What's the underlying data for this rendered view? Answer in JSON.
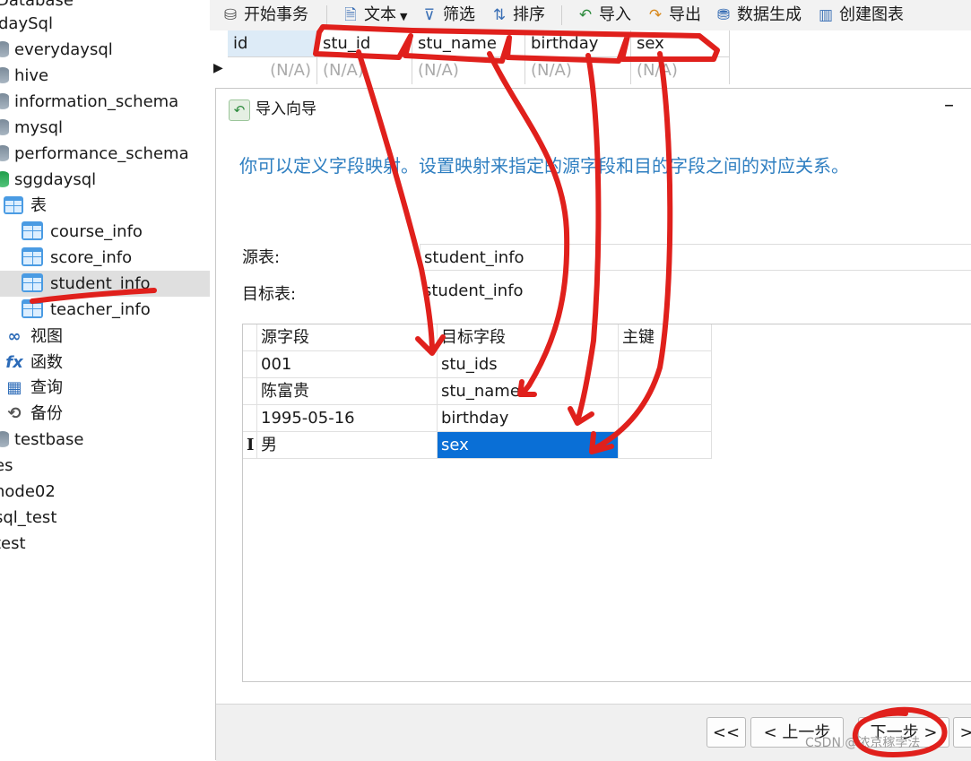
{
  "sidebar": {
    "items": [
      {
        "label": "Database"
      },
      {
        "label": "daySql"
      },
      {
        "label": "everydaysql"
      },
      {
        "label": "hive"
      },
      {
        "label": "information_schema"
      },
      {
        "label": "mysql"
      },
      {
        "label": "performance_schema"
      },
      {
        "label": "sggdaysql"
      },
      {
        "label": "表"
      },
      {
        "label": "course_info"
      },
      {
        "label": "score_info"
      },
      {
        "label": "student_info"
      },
      {
        "label": "teacher_info"
      },
      {
        "label": "视图"
      },
      {
        "label": "函数"
      },
      {
        "label": "查询"
      },
      {
        "label": "备份"
      },
      {
        "label": "testbase"
      },
      {
        "label": "es"
      },
      {
        "label": "node02"
      },
      {
        "label": "sql_test"
      },
      {
        "label": "test"
      }
    ]
  },
  "toolbar": {
    "begin_tx": "开始事务",
    "text": "文本",
    "filter": "筛选",
    "sort": "排序",
    "import": "导入",
    "export": "导出",
    "data_gen": "数据生成",
    "create_chart": "创建图表"
  },
  "grid": {
    "columns": [
      "id",
      "stu_id",
      "stu_name",
      "birthday",
      "sex"
    ],
    "null_value": "(N/A)"
  },
  "dialog": {
    "title": "导入向导",
    "description": "你可以定义字段映射。设置映射来指定的源字段和目的字段之间的对应关系。",
    "source_label": "源表:",
    "source_value": "student_info",
    "target_label": "目标表:",
    "target_value": "student_info",
    "table": {
      "headers": [
        "源字段",
        "目标字段",
        "主键"
      ],
      "rows": [
        {
          "source": "001",
          "target": "stu_ids"
        },
        {
          "source": "陈富贵",
          "target": "stu_name"
        },
        {
          "source": "1995-05-16",
          "target": "birthday"
        },
        {
          "source": "男",
          "target": "sex"
        }
      ]
    },
    "buttons": {
      "first": "<<",
      "prev": "< 上一步",
      "next": "下一步 >",
      "last": ">"
    }
  },
  "watermark": "CSDN @浓京稼孛法",
  "colors": {
    "annotation": "#e0201c",
    "selection": "#0a6fd6",
    "link_text": "#2f7fc1"
  }
}
